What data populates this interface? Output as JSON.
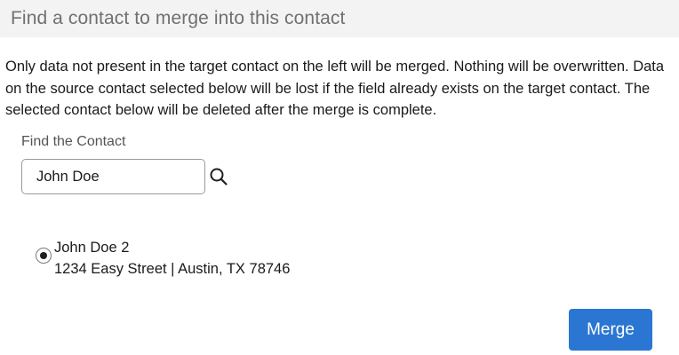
{
  "header": {
    "title": "Find a contact to merge into this contact"
  },
  "description": "Only data not present in the target contact on the left will be merged. Nothing will be overwritten. Data on the source contact selected below will be lost if the field already exists on the target contact. The selected contact below will be deleted after the merge is complete.",
  "search": {
    "label": "Find the Contact",
    "value": "John Doe",
    "icon": "search-icon"
  },
  "results": [
    {
      "name": "John Doe 2",
      "address": "1234 Easy Street | Austin, TX 78746",
      "selected": true
    }
  ],
  "actions": {
    "merge_label": "Merge"
  },
  "colors": {
    "primary": "#2b76d2",
    "header_bg": "#f3f3f3"
  }
}
